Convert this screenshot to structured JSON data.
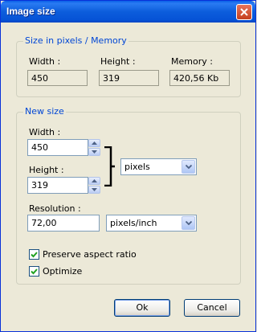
{
  "window": {
    "title": "Image size"
  },
  "icons": {
    "close": "close-icon",
    "spin_up": "arrow-up-icon",
    "spin_down": "arrow-down-icon",
    "dropdown": "chevron-down-icon",
    "check": "checkmark-icon"
  },
  "size_memory": {
    "title": "Size in pixels / Memory",
    "width_label": "Width :",
    "width_value": "450",
    "height_label": "Height :",
    "height_value": "319",
    "memory_label": "Memory :",
    "memory_value": "420,56 Kb"
  },
  "new_size": {
    "title": "New size",
    "width_label": "Width :",
    "width_value": "450",
    "height_label": "Height :",
    "height_value": "319",
    "unit_selected": "pixels",
    "resolution_label": "Resolution :",
    "resolution_value": "72,00",
    "resolution_unit_selected": "pixels/inch"
  },
  "options": {
    "preserve_aspect": {
      "label": "Preserve aspect ratio",
      "checked": true
    },
    "optimize": {
      "label": "Optimize",
      "checked": true
    }
  },
  "buttons": {
    "ok": "Ok",
    "cancel": "Cancel"
  },
  "colors": {
    "title_bar": "#0a5fe8",
    "group_title": "#0046d5",
    "dialog_bg": "#ece9d8"
  }
}
